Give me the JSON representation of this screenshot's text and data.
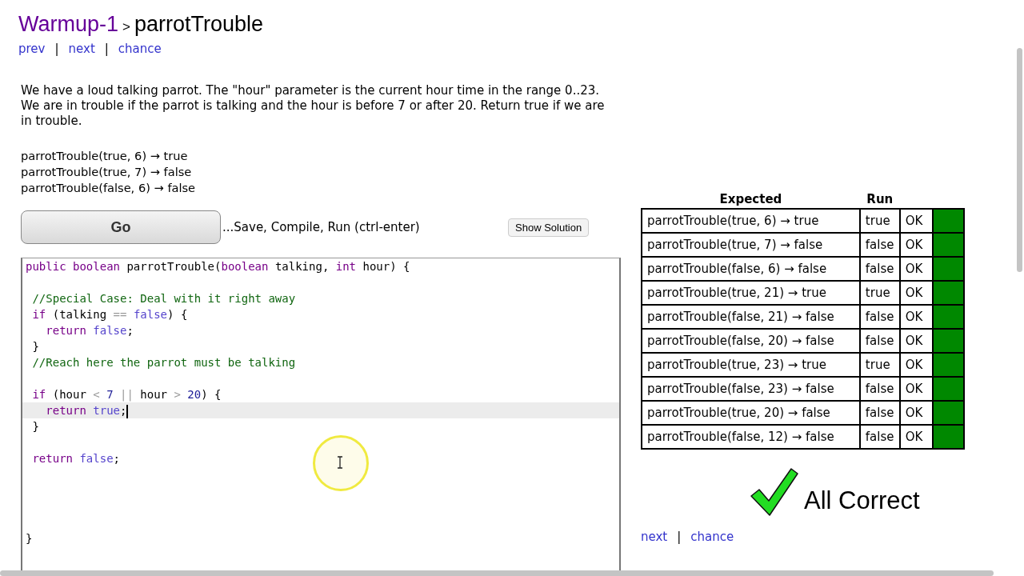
{
  "breadcrumb": {
    "section": "Warmup-1",
    "separator": ">",
    "problem": "parrotTrouble"
  },
  "nav_top": [
    {
      "label": "prev"
    },
    {
      "label": "next"
    },
    {
      "label": "chance"
    }
  ],
  "nav_separator": "|",
  "description": "We have a loud talking parrot. The \"hour\" parameter is the current hour time in the range 0..23. We are in trouble if the parrot is talking and the hour is before 7 or after 20. Return true if we are in trouble.",
  "examples": [
    "parrotTrouble(true, 6) → true",
    "parrotTrouble(true, 7) → false",
    "parrotTrouble(false, 6) → false"
  ],
  "go_button": "Go",
  "go_hint": "...Save, Compile, Run (ctrl-enter)",
  "solution_button": "Show Solution",
  "editor": {
    "lines": [
      {
        "active": false,
        "tokens": [
          {
            "t": "public",
            "color": "#770088"
          },
          {
            "t": " boolean",
            "color": "#770088"
          },
          {
            "t": " parrotTrouble(",
            "color": "#000000"
          },
          {
            "t": "boolean",
            "color": "#770088"
          },
          {
            "t": " talking, ",
            "color": "#000000"
          },
          {
            "t": "int",
            "color": "#770088"
          },
          {
            "t": " hour) {",
            "color": "#000000"
          }
        ]
      },
      {
        "active": false
      },
      {
        "active": false,
        "tokens": [
          {
            "t": " //Special Case: Deal with it right away",
            "color": "#116611"
          }
        ]
      },
      {
        "active": false,
        "tokens": [
          {
            "t": " if",
            "color": "#770088"
          },
          {
            "t": " (talking ",
            "color": "#000000"
          },
          {
            "t": "==",
            "color": "#999999"
          },
          {
            "t": " false",
            "color": "#5544cc"
          },
          {
            "t": ") {",
            "color": "#000000"
          }
        ]
      },
      {
        "active": false,
        "tokens": [
          {
            "t": "   return",
            "color": "#770088"
          },
          {
            "t": " false",
            "color": "#5544cc"
          },
          {
            "t": ";",
            "color": "#000000"
          }
        ]
      },
      {
        "active": false,
        "tokens": [
          {
            "t": " }",
            "color": "#000000"
          }
        ]
      },
      {
        "active": false,
        "tokens": [
          {
            "t": " //Reach here the parrot must be talking",
            "color": "#116611"
          }
        ]
      },
      {
        "active": false
      },
      {
        "active": false,
        "tokens": [
          {
            "t": " if",
            "color": "#770088"
          },
          {
            "t": " (hour ",
            "color": "#000000"
          },
          {
            "t": "<",
            "color": "#999999"
          },
          {
            "t": " 7",
            "color": "#222299"
          },
          {
            "t": " ||",
            "color": "#999999"
          },
          {
            "t": " hour ",
            "color": "#000000"
          },
          {
            "t": ">",
            "color": "#999999"
          },
          {
            "t": " 20",
            "color": "#222299"
          },
          {
            "t": ") {",
            "color": "#000000"
          }
        ]
      },
      {
        "active": true,
        "tokens": [
          {
            "t": "   return",
            "color": "#770088"
          },
          {
            "t": " true",
            "color": "#5544cc"
          },
          {
            "t": ";",
            "color": "#000000"
          }
        ]
      },
      {
        "active": false,
        "tokens": [
          {
            "t": " }",
            "color": "#000000"
          }
        ]
      },
      {
        "active": false
      },
      {
        "active": false,
        "tokens": [
          {
            "t": " return",
            "color": "#770088"
          },
          {
            "t": " false",
            "color": "#5544cc"
          },
          {
            "t": ";",
            "color": "#000000"
          }
        ]
      },
      {
        "active": false
      },
      {
        "active": false
      },
      {
        "active": false
      },
      {
        "active": false
      },
      {
        "active": false,
        "tokens": [
          {
            "t": "}",
            "color": "#000000"
          }
        ]
      }
    ]
  },
  "results": {
    "columns": [
      "Expected",
      "Run"
    ],
    "rows": [
      {
        "expected": "parrotTrouble(true, 6) → true",
        "run": "true",
        "result": "OK",
        "passed": true
      },
      {
        "expected": "parrotTrouble(true, 7) → false",
        "run": "false",
        "result": "OK",
        "passed": true
      },
      {
        "expected": "parrotTrouble(false, 6) → false",
        "run": "false",
        "result": "OK",
        "passed": true
      },
      {
        "expected": "parrotTrouble(true, 21) → true",
        "run": "true",
        "result": "OK",
        "passed": true
      },
      {
        "expected": "parrotTrouble(false, 21) → false",
        "run": "false",
        "result": "OK",
        "passed": true
      },
      {
        "expected": "parrotTrouble(false, 20) → false",
        "run": "false",
        "result": "OK",
        "passed": true
      },
      {
        "expected": "parrotTrouble(true, 23) → true",
        "run": "true",
        "result": "OK",
        "passed": true
      },
      {
        "expected": "parrotTrouble(false, 23) → false",
        "run": "false",
        "result": "OK",
        "passed": true
      },
      {
        "expected": "parrotTrouble(true, 20) → false",
        "run": "false",
        "result": "OK",
        "passed": true
      },
      {
        "expected": "parrotTrouble(false, 12) → false",
        "run": "false",
        "result": "OK",
        "passed": true
      }
    ]
  },
  "verdict": {
    "all_correct": true,
    "text": "All Correct"
  },
  "nav_bottom": [
    {
      "label": "next"
    },
    {
      "label": "chance"
    }
  ]
}
